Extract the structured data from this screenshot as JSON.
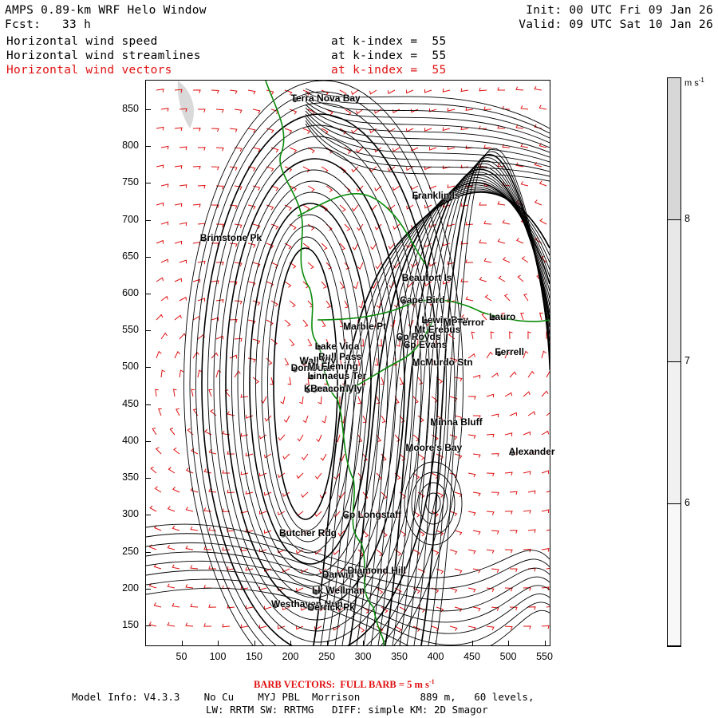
{
  "header": {
    "title": "AMPS 0.89-km WRF Helo Window",
    "forecast_label": "Fcst:",
    "forecast_value": "33 h",
    "init": "Init: 00 UTC Fri 09 Jan 26",
    "valid": "Valid: 09 UTC Sat 10 Jan 26"
  },
  "fields": [
    {
      "name": "Horizontal wind speed",
      "level": "at k-index =  55",
      "color": "#000000"
    },
    {
      "name": "Horizontal wind streamlines",
      "level": "at k-index =  55",
      "color": "#000000"
    },
    {
      "name": "Horizontal wind vectors",
      "level": "at k-index =  55",
      "color": "#e01010"
    }
  ],
  "x_ticks": [
    50,
    100,
    150,
    200,
    250,
    300,
    350,
    400,
    450,
    500,
    550
  ],
  "y_ticks": [
    150,
    200,
    250,
    300,
    350,
    400,
    450,
    500,
    550,
    600,
    650,
    700,
    750,
    800,
    850
  ],
  "colorbar": {
    "unit": "m s",
    "unit_sup": "-1",
    "levels": [
      {
        "label": "8",
        "color": "#d7d7d7"
      },
      {
        "label": "7",
        "color": "#e8e8e8"
      },
      {
        "label": "6",
        "color": "#f1f1f1"
      },
      {
        "label": "",
        "color": "#f8f8f8"
      }
    ]
  },
  "places": [
    {
      "name": "Terra Nova Bay",
      "x": 205,
      "y": 864
    },
    {
      "name": "Franklin Is",
      "x": 372,
      "y": 732
    },
    {
      "name": "Brimstone Pk",
      "x": 80,
      "y": 675
    },
    {
      "name": "Beaufort Is",
      "x": 358,
      "y": 621
    },
    {
      "name": "Cape Bird",
      "x": 355,
      "y": 590
    },
    {
      "name": "Lewis Bay",
      "x": 385,
      "y": 563
    },
    {
      "name": "Mt Terror",
      "x": 415,
      "y": 560
    },
    {
      "name": "Lauro",
      "x": 478,
      "y": 568
    },
    {
      "name": "Marble Pt",
      "x": 277,
      "y": 555
    },
    {
      "name": "Mt Erebus",
      "x": 375,
      "y": 550
    },
    {
      "name": "Cp Royds",
      "x": 350,
      "y": 540
    },
    {
      "name": "Lake Vida",
      "x": 238,
      "y": 528
    },
    {
      "name": "Cp Evans",
      "x": 360,
      "y": 530
    },
    {
      "name": "Ferrell",
      "x": 486,
      "y": 520
    },
    {
      "name": "Bull Pass",
      "x": 243,
      "y": 513
    },
    {
      "name": "Wall Vly",
      "x": 217,
      "y": 508
    },
    {
      "name": "McMurdo Stn",
      "x": 372,
      "y": 506
    },
    {
      "name": "Don Juan",
      "x": 205,
      "y": 498
    },
    {
      "name": "Mt Fleming",
      "x": 228,
      "y": 500
    },
    {
      "name": "Linnaeus Ter",
      "x": 228,
      "y": 488
    },
    {
      "name": "Kennar Vly",
      "x": 223,
      "y": 470
    },
    {
      "name": "Beacon Vly",
      "x": 232,
      "y": 470
    },
    {
      "name": "Minna Bluff",
      "x": 397,
      "y": 425
    },
    {
      "name": "Moore's Bay",
      "x": 363,
      "y": 390
    },
    {
      "name": "Alexander",
      "x": 505,
      "y": 385
    },
    {
      "name": "Cp Longstaff",
      "x": 276,
      "y": 299
    },
    {
      "name": "Butcher Rdg",
      "x": 189,
      "y": 274
    },
    {
      "name": "Darwin Gl",
      "x": 248,
      "y": 218
    },
    {
      "name": "Diamond Hill",
      "x": 283,
      "y": 223
    },
    {
      "name": "Lk Wellman",
      "x": 234,
      "y": 196
    },
    {
      "name": "Westhaven Nun",
      "x": 178,
      "y": 178
    },
    {
      "name": "Derrick Pk",
      "x": 228,
      "y": 174
    }
  ],
  "footer": {
    "barb_note": "BARB VECTORS:  FULL BARB = 5 m s",
    "barb_sup": "-1",
    "model_line": "Model Info: V4.3.3    No Cu    MYJ PBL  Morrison          889 m,   60 levels,",
    "physics_line": "LW: RRTM SW: RRTMG   DIFF: simple KM: 2D Smagor"
  }
}
